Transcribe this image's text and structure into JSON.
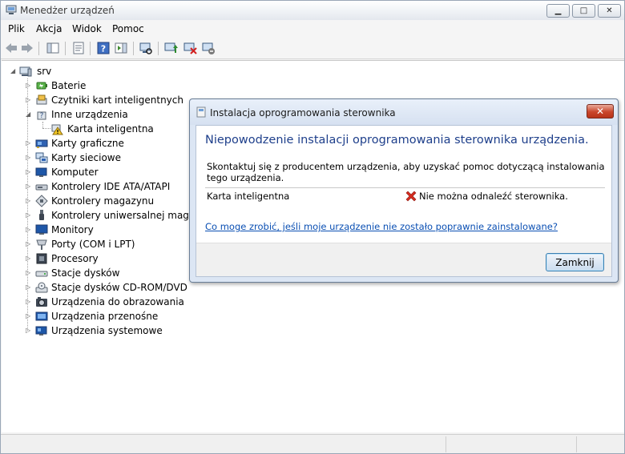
{
  "window": {
    "title": "Menedżer urządzeń"
  },
  "menu": [
    "Plik",
    "Akcja",
    "Widok",
    "Pomoc"
  ],
  "tree": {
    "root": "srv",
    "items": [
      {
        "label": "Baterie",
        "icon": "battery-icon"
      },
      {
        "label": "Czytniki kart inteligentnych",
        "icon": "smartcard-reader-icon"
      },
      {
        "label": "Inne urządzenia",
        "icon": "unknown-device-icon",
        "expanded": true,
        "children": [
          {
            "label": "Karta inteligentna",
            "icon": "warning-device-icon"
          }
        ]
      },
      {
        "label": "Karty graficzne",
        "icon": "display-adapter-icon"
      },
      {
        "label": "Karty sieciowe",
        "icon": "network-adapter-icon"
      },
      {
        "label": "Komputer",
        "icon": "computer-icon"
      },
      {
        "label": "Kontrolery IDE ATA/ATAPI",
        "icon": "ide-controller-icon"
      },
      {
        "label": "Kontrolery magazynu",
        "icon": "storage-controller-icon"
      },
      {
        "label": "Kontrolery uniwersalnej magistrali szeregowej",
        "icon": "usb-controller-icon"
      },
      {
        "label": "Monitory",
        "icon": "monitor-icon"
      },
      {
        "label": "Porty (COM i LPT)",
        "icon": "port-icon"
      },
      {
        "label": "Procesory",
        "icon": "processor-icon"
      },
      {
        "label": "Stacje dysków",
        "icon": "disk-drive-icon"
      },
      {
        "label": "Stacje dysków CD-ROM/DVD",
        "icon": "cdrom-icon"
      },
      {
        "label": "Urządzenia do obrazowania",
        "icon": "imaging-device-icon"
      },
      {
        "label": "Urządzenia przenośne",
        "icon": "portable-device-icon"
      },
      {
        "label": "Urządzenia systemowe",
        "icon": "system-device-icon"
      }
    ]
  },
  "dialog": {
    "title": "Instalacja oprogramowania sterownika",
    "heading": "Niepowodzenie instalacji oprogramowania sterownika urządzenia.",
    "message": "Skontaktuj się z producentem urządzenia, aby uzyskać pomoc dotyczącą instalowania tego urządzenia.",
    "device": "Karta inteligentna",
    "status": "Nie można odnaleźć sterownika.",
    "link": "Co moge zrobić, jeśli moje urządzenie nie zostało poprawnie zainstalowane?",
    "close_label": "Zamknij"
  },
  "colors": {
    "heading": "#1e3f8b",
    "link": "#0a4fb3",
    "error": "#d62b1f",
    "close": "#c9452b"
  }
}
